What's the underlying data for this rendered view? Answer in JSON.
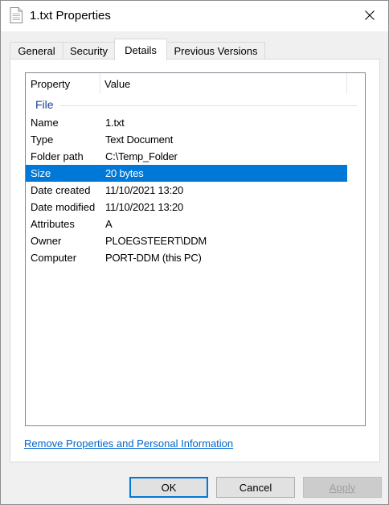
{
  "window": {
    "title": "1.txt Properties"
  },
  "tabs": [
    {
      "label": "General"
    },
    {
      "label": "Security"
    },
    {
      "label": "Details"
    },
    {
      "label": "Previous Versions"
    }
  ],
  "active_tab": "Details",
  "listview": {
    "columns": [
      "Property",
      "Value"
    ],
    "group": "File",
    "rows": [
      {
        "property": "Name",
        "value": "1.txt"
      },
      {
        "property": "Type",
        "value": "Text Document"
      },
      {
        "property": "Folder path",
        "value": "C:\\Temp_Folder"
      },
      {
        "property": "Size",
        "value": "20 bytes",
        "selected": true
      },
      {
        "property": "Date created",
        "value": "11/10/2021 13:20"
      },
      {
        "property": "Date modified",
        "value": "11/10/2021 13:20"
      },
      {
        "property": "Attributes",
        "value": "A"
      },
      {
        "property": "Owner",
        "value": "PLOEGSTEERT\\DDM"
      },
      {
        "property": "Computer",
        "value": "PORT-DDM (this PC)"
      }
    ]
  },
  "link": {
    "label": "Remove Properties and Personal Information"
  },
  "buttons": {
    "ok": "OK",
    "cancel": "Cancel",
    "apply": "Apply"
  },
  "colors": {
    "selection": "#0078d7",
    "link": "#0066cc",
    "group_label": "#1e3f99"
  }
}
